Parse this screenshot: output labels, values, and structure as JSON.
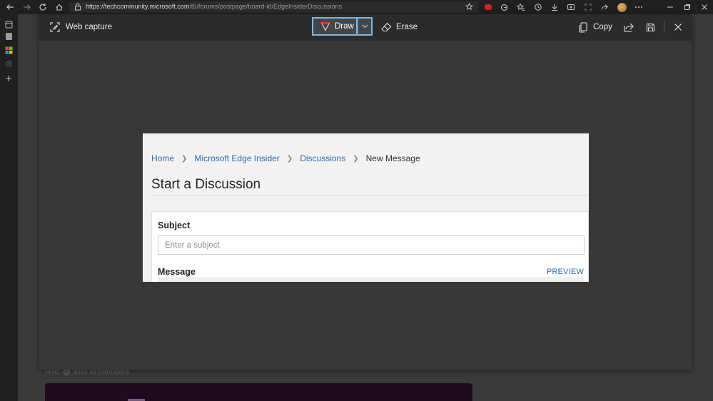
{
  "browser": {
    "url_main": "https://techcommunity.microsoft.com",
    "url_path": "/t5/forums/postpage/board-id/EdgeInsiderDiscussions"
  },
  "background_page": {
    "hint_prefix": "Hint:",
    "hint_at": "@",
    "hint_text": "links to members"
  },
  "capture_toolbar": {
    "title": "Web capture",
    "draw_label": "Draw",
    "erase_label": "Erase",
    "copy_label": "Copy",
    "accent_color": "#7ab8e8"
  },
  "captured": {
    "breadcrumb": [
      "Home",
      "Microsoft Edge Insider",
      "Discussions",
      "New Message"
    ],
    "page_title": "Start a Discussion",
    "subject_label": "Subject",
    "subject_placeholder": "Enter a subject",
    "subject_value": "",
    "message_label": "Message",
    "preview_label": "PREVIEW"
  }
}
